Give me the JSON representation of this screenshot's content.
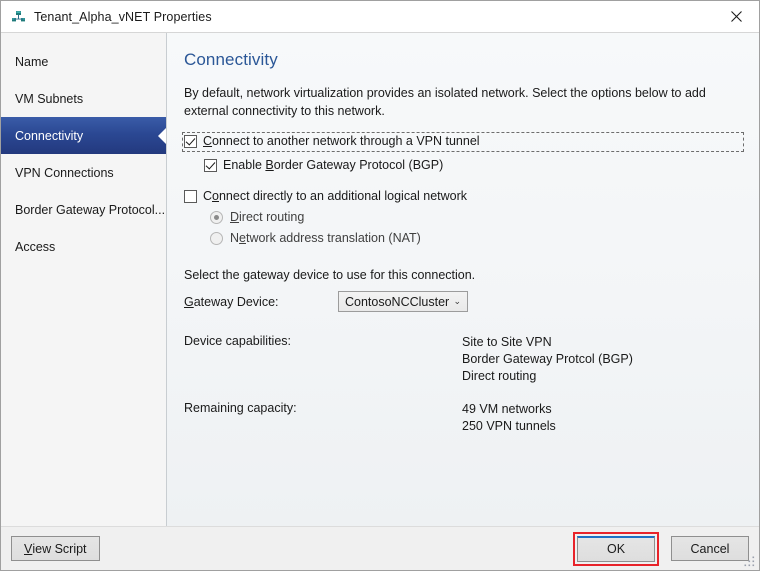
{
  "window": {
    "title": "Tenant_Alpha_vNET Properties",
    "icon": "network-node-icon",
    "close_label": "✕"
  },
  "sidebar": {
    "items": [
      {
        "label": "Name",
        "selected": false
      },
      {
        "label": "VM Subnets",
        "selected": false
      },
      {
        "label": "Connectivity",
        "selected": true
      },
      {
        "label": "VPN Connections",
        "selected": false
      },
      {
        "label": "Border Gateway Protocol...",
        "selected": false
      },
      {
        "label": "Access",
        "selected": false
      }
    ]
  },
  "content": {
    "heading": "Connectivity",
    "intro": "By default, network virtualization provides an isolated network. Select the options below to add external connectivity to this network.",
    "options": {
      "vpn_tunnel": {
        "label_pre": "",
        "accel": "C",
        "label_post": "onnect to another network through a VPN tunnel",
        "checked": true,
        "focused": true
      },
      "bgp": {
        "label_pre": "Enable ",
        "accel": "B",
        "label_post": "order Gateway Protocol (BGP)",
        "checked": true
      },
      "logical_network": {
        "label_pre": "C",
        "accel": "o",
        "label_post": "nnect directly to an additional logical network",
        "checked": false
      },
      "direct_routing": {
        "label_pre": "",
        "accel": "D",
        "label_post": "irect routing",
        "selected": true,
        "disabled": true
      },
      "nat": {
        "label_pre": "N",
        "accel": "e",
        "label_post": "twork address translation (NAT)",
        "selected": false,
        "disabled": true
      }
    },
    "gateway": {
      "instruction": "Select the gateway device to use for this connection.",
      "label_pre": "",
      "label_accel": "G",
      "label_post": "ateway Device:",
      "selected_value": "ContosoNCCluster",
      "chevron": "⌄",
      "options": [
        "ContosoNCCluster"
      ]
    },
    "info": [
      {
        "key": "Device capabilities:",
        "values": [
          "Site to Site VPN",
          "Border Gateway Protcol (BGP)",
          "Direct routing"
        ]
      },
      {
        "key": "Remaining capacity:",
        "values": [
          "49 VM networks",
          "250 VPN tunnels"
        ]
      }
    ]
  },
  "footer": {
    "view_script": {
      "accel": "V",
      "label_post": "iew Script"
    },
    "ok": "OK",
    "cancel": "Cancel"
  },
  "colors": {
    "accent_heading": "#2b5797",
    "nav_selected": "#2b4893",
    "highlight_annotation": "#e8232a",
    "default_button_accent": "#1e6fc4"
  }
}
